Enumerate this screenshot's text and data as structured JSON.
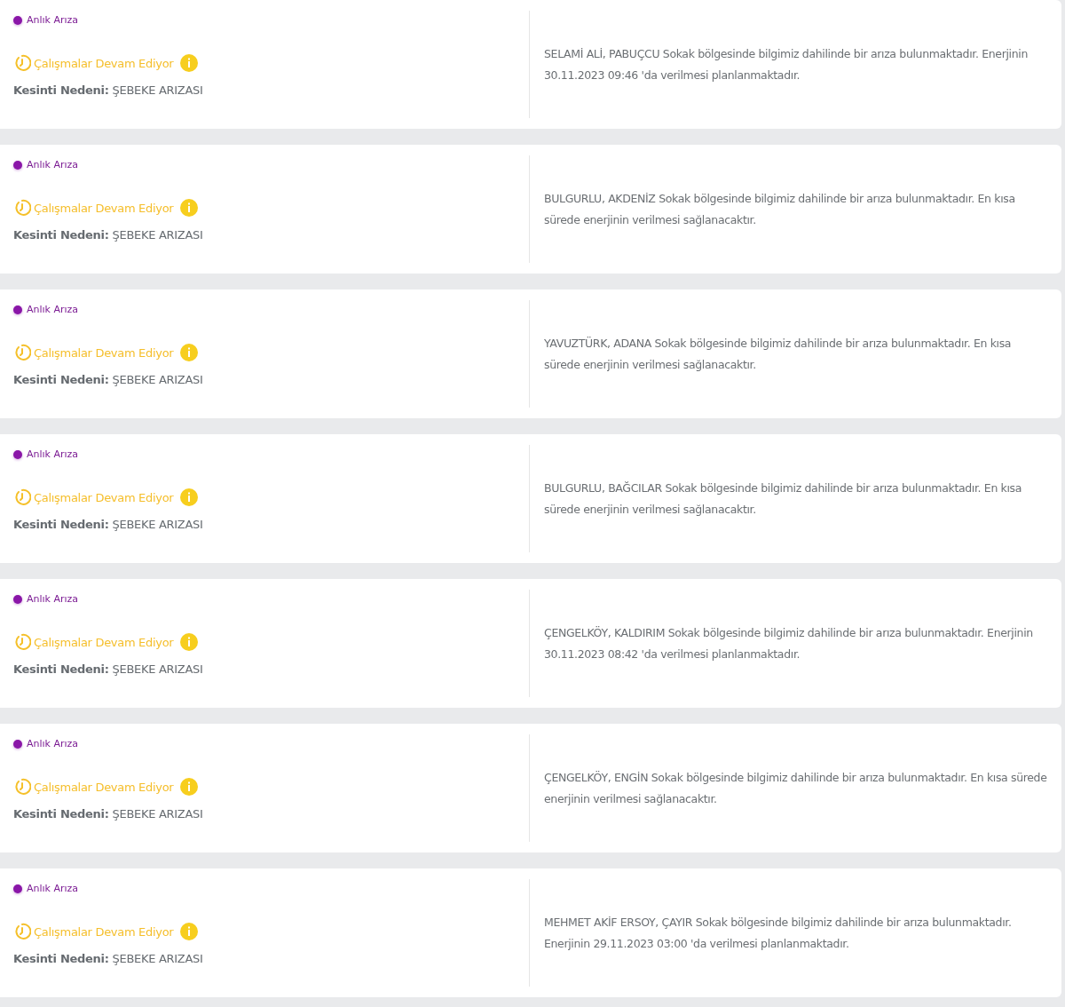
{
  "outages": [
    {
      "type": "Anlık Arıza",
      "status": "Çalışmalar Devam Ediyor",
      "cause_label": "Kesinti Nedeni:",
      "cause": "ŞEBEKE ARIZASI",
      "description": "SELAMİ ALİ, PABUÇCU Sokak bölgesinde bilgimiz dahilinde bir arıza bulunmaktadır. Enerjinin 30.11.2023 09:46 'da verilmesi planlanmaktadır."
    },
    {
      "type": "Anlık Arıza",
      "status": "Çalışmalar Devam Ediyor",
      "cause_label": "Kesinti Nedeni:",
      "cause": "ŞEBEKE ARIZASI",
      "description": "BULGURLU, AKDENİZ Sokak bölgesinde bilgimiz dahilinde bir arıza bulunmaktadır. En kısa sürede enerjinin verilmesi sağlanacaktır."
    },
    {
      "type": "Anlık Arıza",
      "status": "Çalışmalar Devam Ediyor",
      "cause_label": "Kesinti Nedeni:",
      "cause": "ŞEBEKE ARIZASI",
      "description": "YAVUZTÜRK, ADANA Sokak bölgesinde bilgimiz dahilinde bir arıza bulunmaktadır. En kısa sürede enerjinin verilmesi sağlanacaktır."
    },
    {
      "type": "Anlık Arıza",
      "status": "Çalışmalar Devam Ediyor",
      "cause_label": "Kesinti Nedeni:",
      "cause": "ŞEBEKE ARIZASI",
      "description": "BULGURLU, BAĞCILAR Sokak bölgesinde bilgimiz dahilinde bir arıza bulunmaktadır. En kısa sürede enerjinin verilmesi sağlanacaktır."
    },
    {
      "type": "Anlık Arıza",
      "status": "Çalışmalar Devam Ediyor",
      "cause_label": "Kesinti Nedeni:",
      "cause": "ŞEBEKE ARIZASI",
      "description": "ÇENGELKÖY, KALDIRIM Sokak bölgesinde bilgimiz dahilinde bir arıza bulunmaktadır. Enerjinin 30.11.2023 08:42 'da verilmesi planlanmaktadır."
    },
    {
      "type": "Anlık Arıza",
      "status": "Çalışmalar Devam Ediyor",
      "cause_label": "Kesinti Nedeni:",
      "cause": "ŞEBEKE ARIZASI",
      "description": "ÇENGELKÖY, ENGİN Sokak bölgesinde bilgimiz dahilinde bir arıza bulunmaktadır. En kısa sürede enerjinin verilmesi sağlanacaktır."
    },
    {
      "type": "Anlık Arıza",
      "status": "Çalışmalar Devam Ediyor",
      "cause_label": "Kesinti Nedeni:",
      "cause": "ŞEBEKE ARIZASI",
      "description": "MEHMET AKİF ERSOY, ÇAYIR Sokak bölgesinde bilgimiz dahilinde bir arıza bulunmaktadır. Enerjinin 29.11.2023 03:00 'da verilmesi planlanmaktadır."
    }
  ]
}
